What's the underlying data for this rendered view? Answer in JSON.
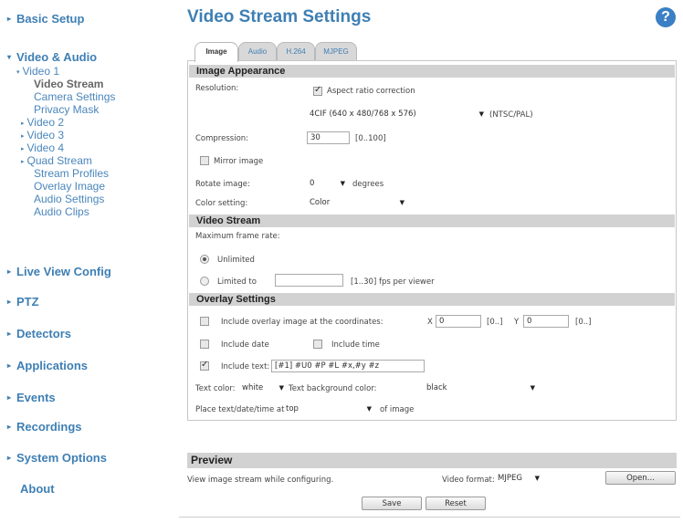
{
  "sidebar": {
    "basic_setup": "Basic Setup",
    "video_audio": "Video & Audio",
    "video1": "Video 1",
    "video_stream": "Video Stream",
    "camera_settings": "Camera Settings",
    "privacy_mask": "Privacy Mask",
    "video2": "Video 2",
    "video3": "Video 3",
    "video4": "Video 4",
    "quad_stream": "Quad Stream",
    "stream_profiles": "Stream Profiles",
    "overlay_image": "Overlay Image",
    "audio_settings": "Audio Settings",
    "audio_clips": "Audio Clips",
    "live_view_config": "Live View Config",
    "ptz": "PTZ",
    "detectors": "Detectors",
    "applications": "Applications",
    "events": "Events",
    "recordings": "Recordings",
    "system_options": "System Options",
    "about": "About"
  },
  "header": {
    "title": "Video Stream Settings",
    "help": "?"
  },
  "tabs": {
    "image": "Image",
    "audio": "Audio",
    "h264": "H.264",
    "mjpeg": "MJPEG"
  },
  "image_appearance": {
    "heading": "Image Appearance",
    "resolution_label": "Resolution:",
    "aspect_ratio": "Aspect ratio correction",
    "aspect_ratio_checked": true,
    "resolution_value": "4CIF (640 x 480/768 x 576)",
    "resolution_suffix": "(NTSC/PAL)",
    "compression_label": "Compression:",
    "compression_value": "30",
    "compression_range": "[0..100]",
    "mirror_label": "Mirror image",
    "mirror_checked": false,
    "rotate_label": "Rotate image:",
    "rotate_value": "0",
    "rotate_unit": "degrees",
    "color_label": "Color setting:",
    "color_value": "Color"
  },
  "video_stream": {
    "heading": "Video Stream",
    "max_fps_label": "Maximum frame rate:",
    "unlimited": "Unlimited",
    "unlimited_selected": true,
    "limited_to": "Limited to",
    "limited_value": "",
    "limited_range": "[1..30] fps per viewer"
  },
  "overlay": {
    "heading": "Overlay Settings",
    "include_overlay": "Include overlay image at the coordinates:",
    "include_overlay_checked": false,
    "x_label": "X",
    "x_value": "0",
    "x_range": "[0..]",
    "y_label": "Y",
    "y_value": "0",
    "y_range": "[0..]",
    "include_date": "Include date",
    "include_date_checked": false,
    "include_time": "Include time",
    "include_time_checked": false,
    "include_text": "Include text:",
    "include_text_checked": true,
    "text_value": "[#1] #U0 #P #L #x,#y #z",
    "text_color_label": "Text color:",
    "text_color_value": "white",
    "text_bg_label": "Text background color:",
    "text_bg_value": "black",
    "place_label": "Place text/date/time at",
    "place_value": "top",
    "place_suffix": "of image"
  },
  "preview": {
    "heading": "Preview",
    "description": "View image stream while configuring.",
    "format_label": "Video format:",
    "format_value": "MJPEG",
    "open_button": "Open..."
  },
  "actions": {
    "save": "Save",
    "reset": "Reset"
  },
  "colors": {
    "accent": "#3e7fb4",
    "section_bg": "#d2d2d2",
    "help_bg": "#3b7fc4"
  }
}
